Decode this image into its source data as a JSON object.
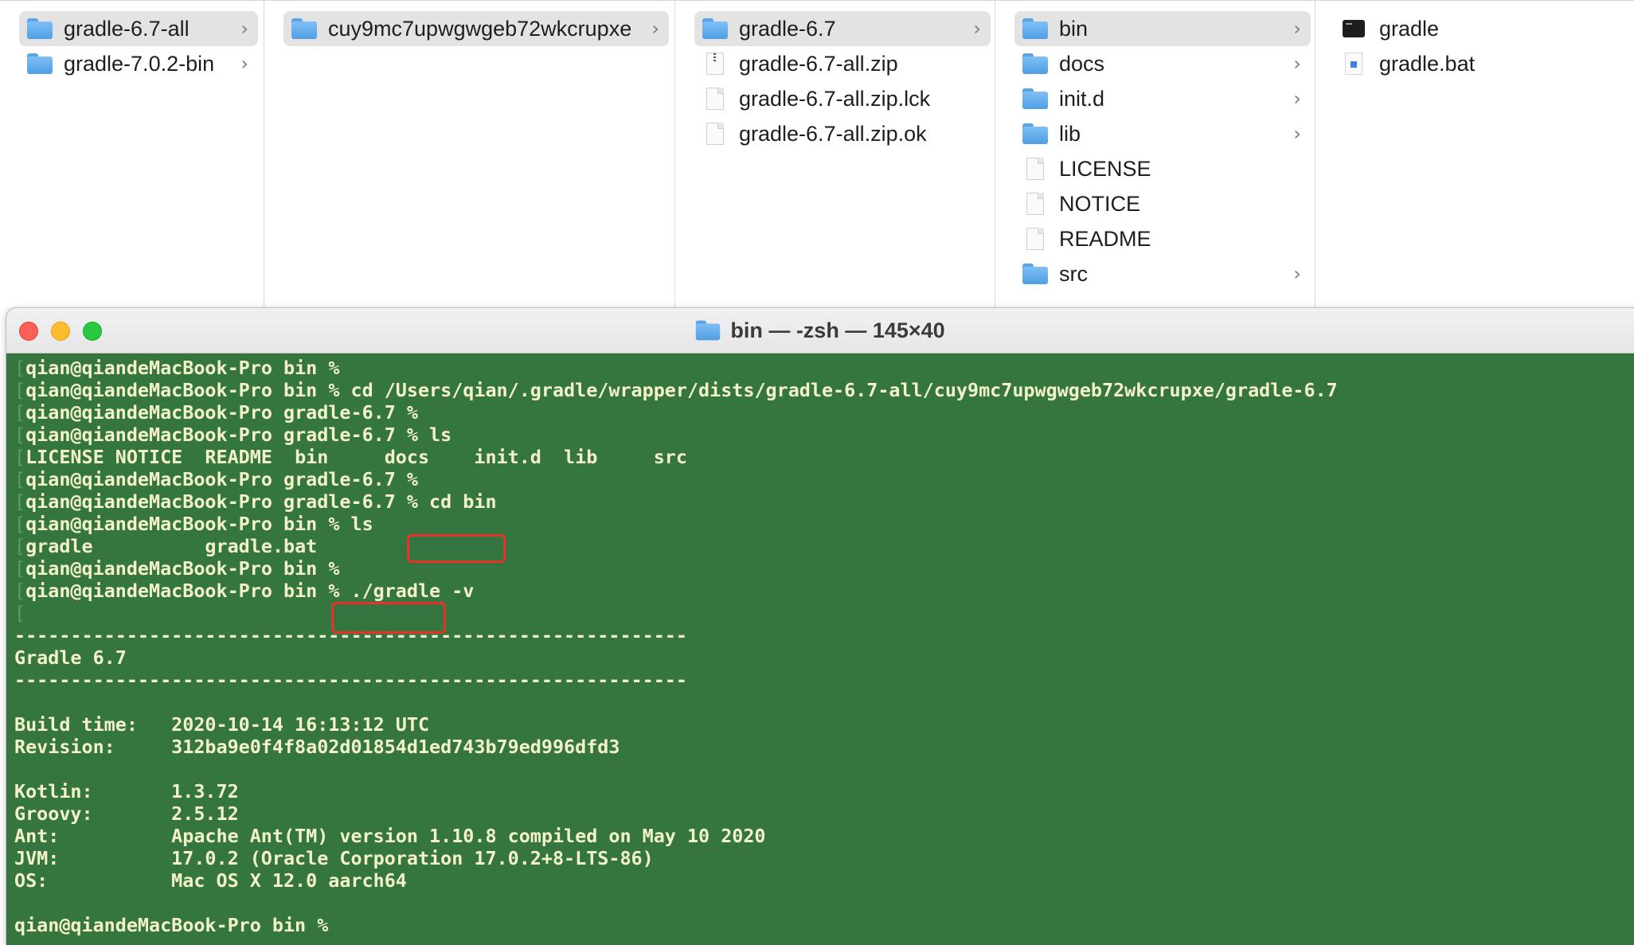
{
  "finder": {
    "columns": [
      {
        "items": [
          {
            "name": "gradle-6.7-all",
            "type": "folder",
            "selected": true,
            "chevron": true
          },
          {
            "name": "gradle-7.0.2-bin",
            "type": "folder",
            "selected": false,
            "chevron": true
          }
        ]
      },
      {
        "items": [
          {
            "name": "cuy9mc7upwgwgeb72wkcrupxe",
            "type": "folder",
            "selected": true,
            "chevron": true
          }
        ]
      },
      {
        "items": [
          {
            "name": "gradle-6.7",
            "type": "folder",
            "selected": true,
            "chevron": true
          },
          {
            "name": "gradle-6.7-all.zip",
            "type": "zip",
            "selected": false,
            "chevron": false
          },
          {
            "name": "gradle-6.7-all.zip.lck",
            "type": "doc",
            "selected": false,
            "chevron": false
          },
          {
            "name": "gradle-6.7-all.zip.ok",
            "type": "doc",
            "selected": false,
            "chevron": false
          }
        ]
      },
      {
        "items": [
          {
            "name": "bin",
            "type": "folder",
            "selected": true,
            "chevron": true
          },
          {
            "name": "docs",
            "type": "folder",
            "selected": false,
            "chevron": true
          },
          {
            "name": "init.d",
            "type": "folder",
            "selected": false,
            "chevron": true
          },
          {
            "name": "lib",
            "type": "folder",
            "selected": false,
            "chevron": true
          },
          {
            "name": "LICENSE",
            "type": "doc",
            "selected": false,
            "chevron": false
          },
          {
            "name": "NOTICE",
            "type": "doc",
            "selected": false,
            "chevron": false
          },
          {
            "name": "README",
            "type": "doc",
            "selected": false,
            "chevron": false
          },
          {
            "name": "src",
            "type": "folder",
            "selected": false,
            "chevron": true
          }
        ]
      },
      {
        "items": [
          {
            "name": "gradle",
            "type": "exec",
            "selected": false,
            "chevron": false
          },
          {
            "name": "gradle.bat",
            "type": "bat",
            "selected": false,
            "chevron": false
          }
        ]
      }
    ],
    "chevron_glyph": "›"
  },
  "terminal": {
    "title": "bin — -zsh — 145×40",
    "background": "#357640",
    "text_color": "#f3f2c9",
    "highlight_color": "#e63229",
    "lines": [
      "qian@qiandeMacBook-Pro bin %",
      "qian@qiandeMacBook-Pro bin % cd /Users/qian/.gradle/wrapper/dists/gradle-6.7-all/cuy9mc7upwgwgeb72wkcrupxe/gradle-6.7",
      "qian@qiandeMacBook-Pro gradle-6.7 %",
      "qian@qiandeMacBook-Pro gradle-6.7 % ls",
      "LICENSE NOTICE  README  bin     docs    init.d  lib     src",
      "qian@qiandeMacBook-Pro gradle-6.7 %",
      "qian@qiandeMacBook-Pro gradle-6.7 % cd bin",
      "qian@qiandeMacBook-Pro bin % ls",
      "gradle          gradle.bat",
      "qian@qiandeMacBook-Pro bin %",
      "qian@qiandeMacBook-Pro bin % ./gradle -v",
      "",
      "------------------------------------------------------------",
      "Gradle 6.7",
      "------------------------------------------------------------",
      "",
      "Build time:   2020-10-14 16:13:12 UTC",
      "Revision:     312ba9e0f4f8a02d01854d1ed743b79ed996dfd3",
      "",
      "Kotlin:       1.3.72",
      "Groovy:       2.5.12",
      "Ant:          Apache Ant(TM) version 1.10.8 compiled on May 10 2020",
      "JVM:          17.0.2 (Oracle Corporation 17.0.2+8-LTS-86)",
      "OS:           Mac OS X 12.0 aarch64",
      "",
      "qian@qiandeMacBook-Pro bin %"
    ]
  }
}
